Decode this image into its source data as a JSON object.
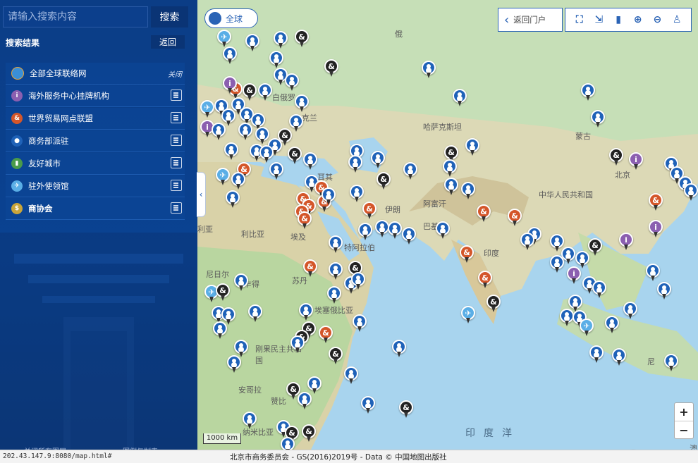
{
  "search": {
    "placeholder": "请输入搜索内容",
    "button_label": "搜索"
  },
  "results": {
    "title": "搜索结果",
    "back_label": "返回"
  },
  "layers": [
    {
      "label": "全部全球联络网",
      "action": "关闭",
      "icon_color": "#e8a53a",
      "icon": "globe-icon",
      "bold": false
    },
    {
      "label": "海外服务中心挂牌机构",
      "icon_color": "#8b5fb0",
      "icon": "info-pin-icon",
      "bold": false
    },
    {
      "label": "世界贸易网点联盟",
      "icon_color": "#d4562a",
      "icon": "ampersand-pin-icon",
      "bold": false
    },
    {
      "label": "商务部派驻",
      "icon_color": "#1f62b8",
      "icon": "person-pin-icon",
      "bold": false
    },
    {
      "label": "友好城市",
      "icon_color": "#4a9a4a",
      "icon": "city-pin-icon",
      "bold": false
    },
    {
      "label": "驻外使领馆",
      "icon_color": "#5aaee6",
      "icon": "plane-pin-icon",
      "bold": false
    },
    {
      "label": "商协会",
      "icon_color": "#c9a53a",
      "icon": "dollar-pin-icon",
      "bold": true
    }
  ],
  "sidebar_footer": {
    "left": "关闭所有图层",
    "right": "图例与制表"
  },
  "map": {
    "global_button": "全球",
    "back_portal": "返回门户",
    "toolbar_icons": [
      "fullscreen-icon",
      "export-icon",
      "measure-icon",
      "zoom-in-icon",
      "zoom-out-icon",
      "locate-person-icon"
    ],
    "zoom_in": "+",
    "zoom_out": "−",
    "scale": "1000 km",
    "places": {
      "russia": "俄",
      "belarus": "白俄罗",
      "ukraine": "克兰",
      "kazakhstan": "哈萨克斯坦",
      "mongolia": "蒙古",
      "beijing": "北京",
      "china": "中华人民共和国",
      "afghanistan": "阿富汗",
      "iran": "伊朗",
      "pakistan": "巴基斯",
      "india": "印度",
      "saudi": "特阿拉伯",
      "egypt": "埃及",
      "libya": "利比亚",
      "algeria": "利亚",
      "niger": "尼日尔",
      "chad": "乍得",
      "sudan": "苏丹",
      "ethiopia": "埃塞俄比亚",
      "congo": "刚果民主共和国",
      "angola": "安哥拉",
      "zambia": "赞比",
      "namibia": "纳米比亚",
      "turkey": "耳其",
      "indian_ocean": "印度洋",
      "australia": "澳",
      "indonesia": "尼"
    }
  },
  "status": {
    "url": "202.43.147.9:8080/map.html#",
    "attribution": "北京市商务委员会 - GS(2016)2019号 - Data © 中国地图出版社"
  }
}
